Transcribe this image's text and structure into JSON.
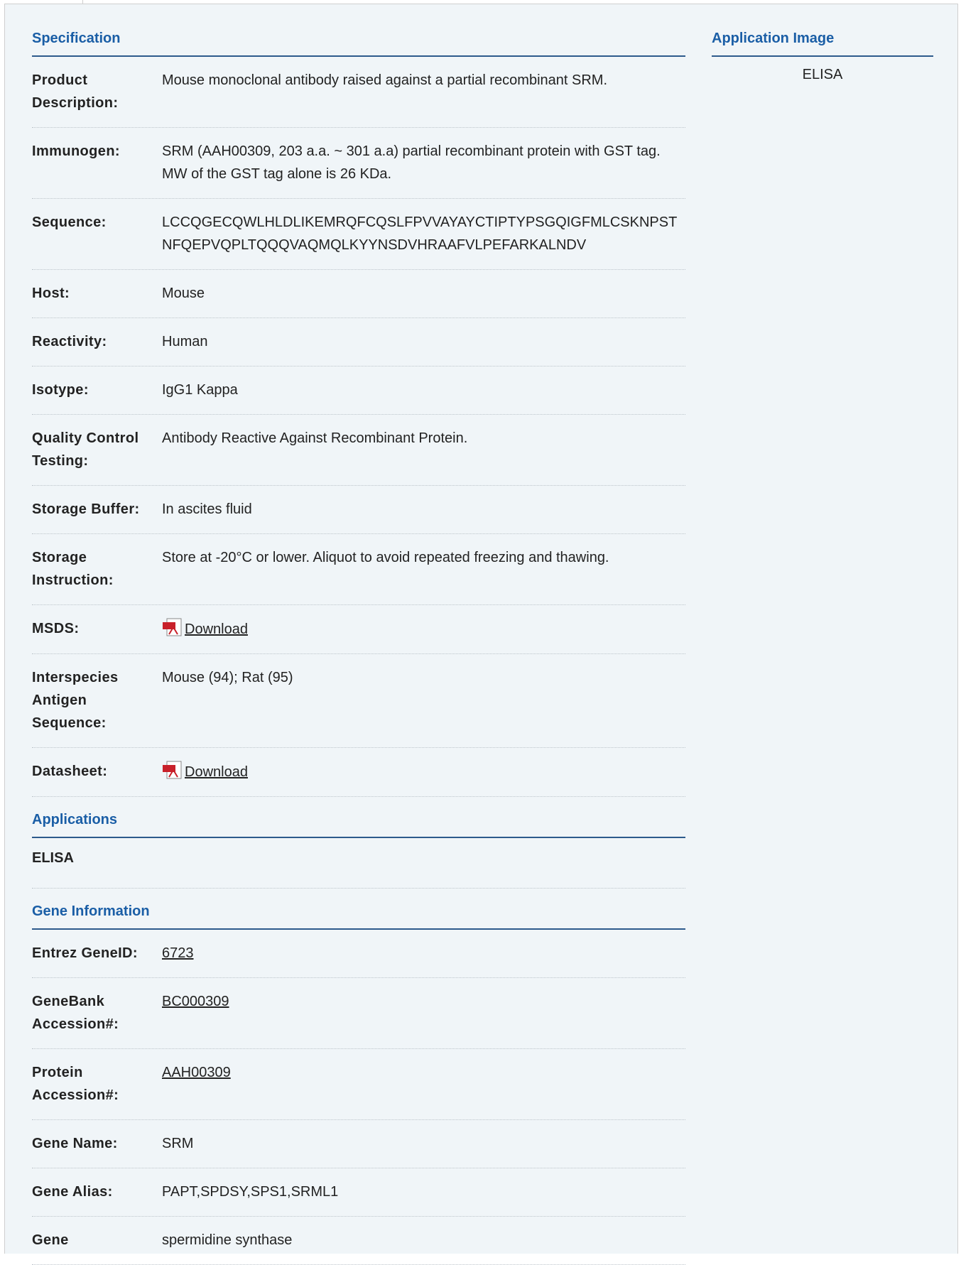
{
  "specification": {
    "title": "Specification",
    "rows": [
      {
        "label": "Product Description:",
        "value": "Mouse monoclonal antibody raised against a partial recombinant SRM."
      },
      {
        "label": "Immunogen:",
        "value": "SRM (AAH00309, 203 a.a. ~ 301 a.a) partial recombinant protein with GST tag. MW of the GST tag alone is 26 KDa."
      },
      {
        "label": "Sequence:",
        "value": "LCCQGECQWLHLDLIKEMRQFCQSLFPVVAYAYCTIPTYPSGQIGFMLCSKNPSTNFQEPVQPLTQQQVAQMQLKYYNSDVHRAAFVLPEFARKALNDV"
      },
      {
        "label": "Host:",
        "value": "Mouse"
      },
      {
        "label": "Reactivity:",
        "value": "Human"
      },
      {
        "label": "Isotype:",
        "value": "IgG1 Kappa"
      },
      {
        "label": "Quality Control Testing:",
        "value": "Antibody Reactive Against Recombinant Protein."
      },
      {
        "label": "Storage Buffer:",
        "value": "In ascites fluid"
      },
      {
        "label": "Storage Instruction:",
        "value": "Store at -20°C or lower. Aliquot to avoid repeated freezing and thawing."
      },
      {
        "label": "MSDS:",
        "link": "Download",
        "icon": "pdf-icon"
      },
      {
        "label": "Interspecies Antigen Sequence:",
        "value": "Mouse (94); Rat (95)"
      },
      {
        "label": "Datasheet:",
        "link": "Download",
        "icon": "pdf-icon"
      }
    ]
  },
  "applications": {
    "title": "Applications",
    "items": [
      "ELISA"
    ]
  },
  "gene_information": {
    "title": "Gene Information",
    "rows": [
      {
        "label": "Entrez GeneID:",
        "link": "6723"
      },
      {
        "label": "GeneBank Accession#:",
        "link": "BC000309"
      },
      {
        "label": "Protein Accession#:",
        "link": "AAH00309"
      },
      {
        "label": "Gene Name:",
        "value": "SRM"
      },
      {
        "label": "Gene Alias:",
        "value": "PAPT,SPDSY,SPS1,SRML1"
      },
      {
        "label": "Gene",
        "value": "spermidine synthase"
      }
    ]
  },
  "application_image": {
    "title": "Application Image",
    "caption": "ELISA"
  },
  "colors": {
    "heading": "#1a5ea6",
    "heading_rule": "#2d5a8c",
    "panel_bg": "#f0f5f8",
    "pdf_red": "#c8202a"
  }
}
